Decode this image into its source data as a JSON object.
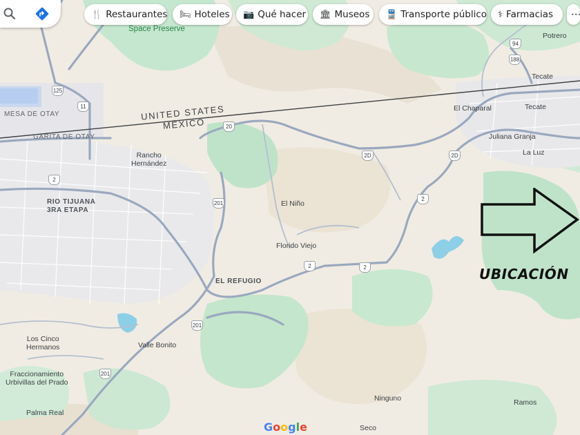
{
  "toolbar": {
    "search_icon": "search-icon",
    "directions_icon": "directions-icon",
    "chips": [
      {
        "label": "Restaurantes",
        "icon": "restaurant-icon",
        "glyph": "🍴"
      },
      {
        "label": "Hoteles",
        "icon": "hotel-icon",
        "glyph": "🛏"
      },
      {
        "label": "Qué hacer",
        "icon": "camera-icon",
        "glyph": "📷"
      },
      {
        "label": "Museos",
        "icon": "museum-icon",
        "glyph": "🏛"
      },
      {
        "label": "Transporte público",
        "icon": "transit-icon",
        "glyph": "🚆"
      },
      {
        "label": "Farmacias",
        "icon": "pharmacy-icon",
        "glyph": "⚕"
      },
      {
        "label": "•••",
        "icon": "more-icon",
        "glyph": ""
      }
    ]
  },
  "map": {
    "border_labels": {
      "north": "UNITED STATES",
      "south": "MÉXICO"
    },
    "park_label": "Space Preserve",
    "places": {
      "mesa_de_otay": "MESA DE OTAY",
      "garita_de_otay": "GARITA DE OTAY",
      "rancho_hernandez_1": "Rancho",
      "rancho_hernandez_2": "Hernández",
      "rio_tijuana_1": "RIO TIJUANA",
      "rio_tijuana_2": "3RA ETAPA",
      "el_nino": "El Niño",
      "florido_viejo": "Florido Viejo",
      "el_refugio": "EL REFUGIO",
      "el_chaparal": "El Chaparal",
      "tecate_mx": "Tecate",
      "tecate_us": "Tecate",
      "potrero": "Potrero",
      "juliana_granja": "Juliana Granja",
      "la_luz": "La Luz",
      "los_cinco_1": "Los Cinco",
      "los_cinco_2": "Hermanos",
      "valle_bonito": "Valle Bonito",
      "fracc_1": "Fraccionamiento",
      "fracc_2": "Urbivillas del Prado",
      "palma_real": "Palma Real",
      "ninguno": "Ninguno",
      "ramos": "Ramos",
      "seco": "Seco"
    },
    "shields": {
      "s125": "125",
      "s11": "11",
      "s2a": "2",
      "s20a": "20",
      "s2d_a": "2D",
      "s2d_b": "2D",
      "s201a": "201",
      "s2b": "2",
      "s2c": "2",
      "s2e": "2",
      "s201b": "201",
      "s201c": "201",
      "s94": "94",
      "s188": "188",
      "s2f": "2"
    }
  },
  "annotation": {
    "label": "UBICACIÓN",
    "arrow_icon": "right-arrow-icon"
  },
  "attribution": {
    "logo": "Google"
  }
}
